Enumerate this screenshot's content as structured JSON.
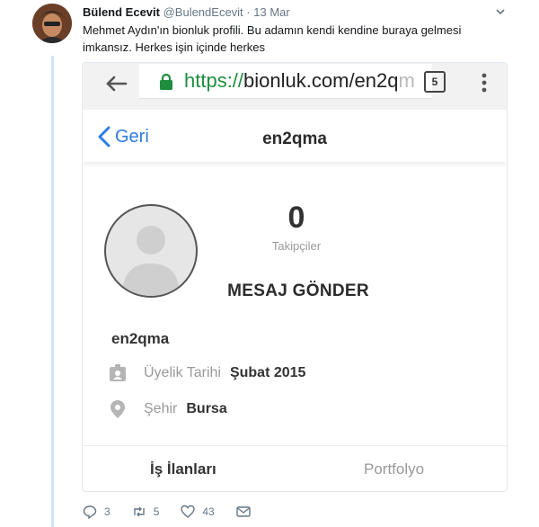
{
  "tweet": {
    "author_name": "Bülend Ecevit",
    "handle": "@BulendEcevit",
    "separator": "·",
    "date": "13 Mar",
    "text": "Mehmet Aydın'ın bionluk profili. Bu adamın kendi kendine buraya gelmesi imkansız. Herkes işin içinde herkes"
  },
  "embed": {
    "browser": {
      "url_scheme": "https://",
      "url_host": "bionluk.com/en2q",
      "url_fade": "m",
      "tab_count": "5"
    },
    "app": {
      "back_label": "Geri",
      "title": "en2qma"
    },
    "profile": {
      "followers_count": "0",
      "followers_label": "Takipçiler",
      "message_button": "MESAJ GÖNDER",
      "username": "en2qma",
      "membership_label": "Üyelik Tarihi",
      "membership_value": "Şubat 2015",
      "city_label": "Şehir",
      "city_value": "Bursa"
    },
    "tabs": [
      "İş İlanları",
      "Portfolyo"
    ]
  },
  "actions": {
    "replies": "3",
    "retweets": "5",
    "likes": "43"
  },
  "colors": {
    "link_blue": "#2d7de0",
    "secure_green": "#1e8e3e",
    "thread_line": "#cfe3f5"
  }
}
